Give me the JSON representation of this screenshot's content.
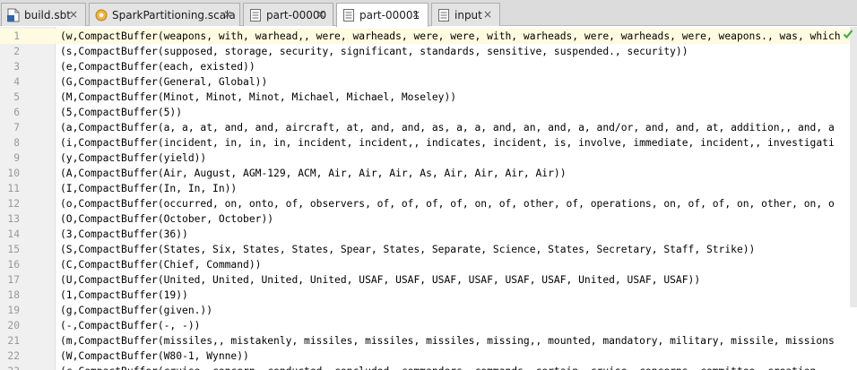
{
  "tabs": [
    {
      "label": "build.sbt",
      "icon": "sbt-file-icon",
      "active": false
    },
    {
      "label": "SparkPartitioning.scala",
      "icon": "scala-object-icon",
      "active": false
    },
    {
      "label": "part-00000",
      "icon": "text-file-icon",
      "active": false
    },
    {
      "label": "part-00001",
      "icon": "text-file-icon",
      "active": true
    },
    {
      "label": "input",
      "icon": "text-file-icon",
      "active": false
    }
  ],
  "close_glyph": "×",
  "editor": {
    "current_line": 1,
    "lines": [
      {
        "n": "1",
        "text": "(w,CompactBuffer(weapons, with, warhead,, were, warheads, were, were, with, warheads, were, warheads, were, weapons., was, which"
      },
      {
        "n": "2",
        "text": "(s,CompactBuffer(supposed, storage, security, significant, standards, sensitive, suspended., security))"
      },
      {
        "n": "3",
        "text": "(e,CompactBuffer(each, existed))"
      },
      {
        "n": "4",
        "text": "(G,CompactBuffer(General, Global))"
      },
      {
        "n": "5",
        "text": "(M,CompactBuffer(Minot, Minot, Minot, Michael, Michael, Moseley))"
      },
      {
        "n": "6",
        "text": "(5,CompactBuffer(5))"
      },
      {
        "n": "7",
        "text": "(a,CompactBuffer(a, a, at, and, and, aircraft, at, and, and, as, a, a, and, an, and, a, and/or, and, and, at, addition,, and, a"
      },
      {
        "n": "8",
        "text": "(i,CompactBuffer(incident, in, in, in, incident, incident,, indicates, incident, is, involve, immediate, incident,, investigati"
      },
      {
        "n": "9",
        "text": "(y,CompactBuffer(yield))"
      },
      {
        "n": "10",
        "text": "(A,CompactBuffer(Air, August, AGM-129, ACM, Air, Air, Air, As, Air, Air, Air, Air))"
      },
      {
        "n": "11",
        "text": "(I,CompactBuffer(In, In, In))"
      },
      {
        "n": "12",
        "text": "(o,CompactBuffer(occurred, on, onto, of, observers, of, of, of, of, on, of, other, of, operations, on, of, of, on, other, on, o"
      },
      {
        "n": "13",
        "text": "(O,CompactBuffer(October, October))"
      },
      {
        "n": "14",
        "text": "(3,CompactBuffer(36))"
      },
      {
        "n": "15",
        "text": "(S,CompactBuffer(States, Six, States, States, Spear, States, Separate, Science, States, Secretary, Staff, Strike))"
      },
      {
        "n": "16",
        "text": "(C,CompactBuffer(Chief, Command))"
      },
      {
        "n": "17",
        "text": "(U,CompactBuffer(United, United, United, United, USAF, USAF, USAF, USAF, USAF, USAF, United, USAF, USAF))"
      },
      {
        "n": "18",
        "text": "(1,CompactBuffer(19))"
      },
      {
        "n": "19",
        "text": "(g,CompactBuffer(given.))"
      },
      {
        "n": "20",
        "text": "(-,CompactBuffer(-, -))"
      },
      {
        "n": "21",
        "text": "(m,CompactBuffer(missiles,, mistakenly, missiles, missiles, missiles, missing,, mounted, mandatory, military, missile, missions"
      },
      {
        "n": "22",
        "text": "(W,CompactBuffer(W80-1, Wynne))"
      },
      {
        "n": "23",
        "text": "(c,CompactBuffer(cruise, concern, conducted, concluded, commanders, commands, certain, cruise, concerns, committee, creation"
      }
    ]
  },
  "colors": {
    "current_line_bg": "#fffbe0",
    "gutter_bg": "#f0f0f0",
    "tabbar_bg": "#dcdcdc",
    "check_color": "#3fae3f"
  }
}
